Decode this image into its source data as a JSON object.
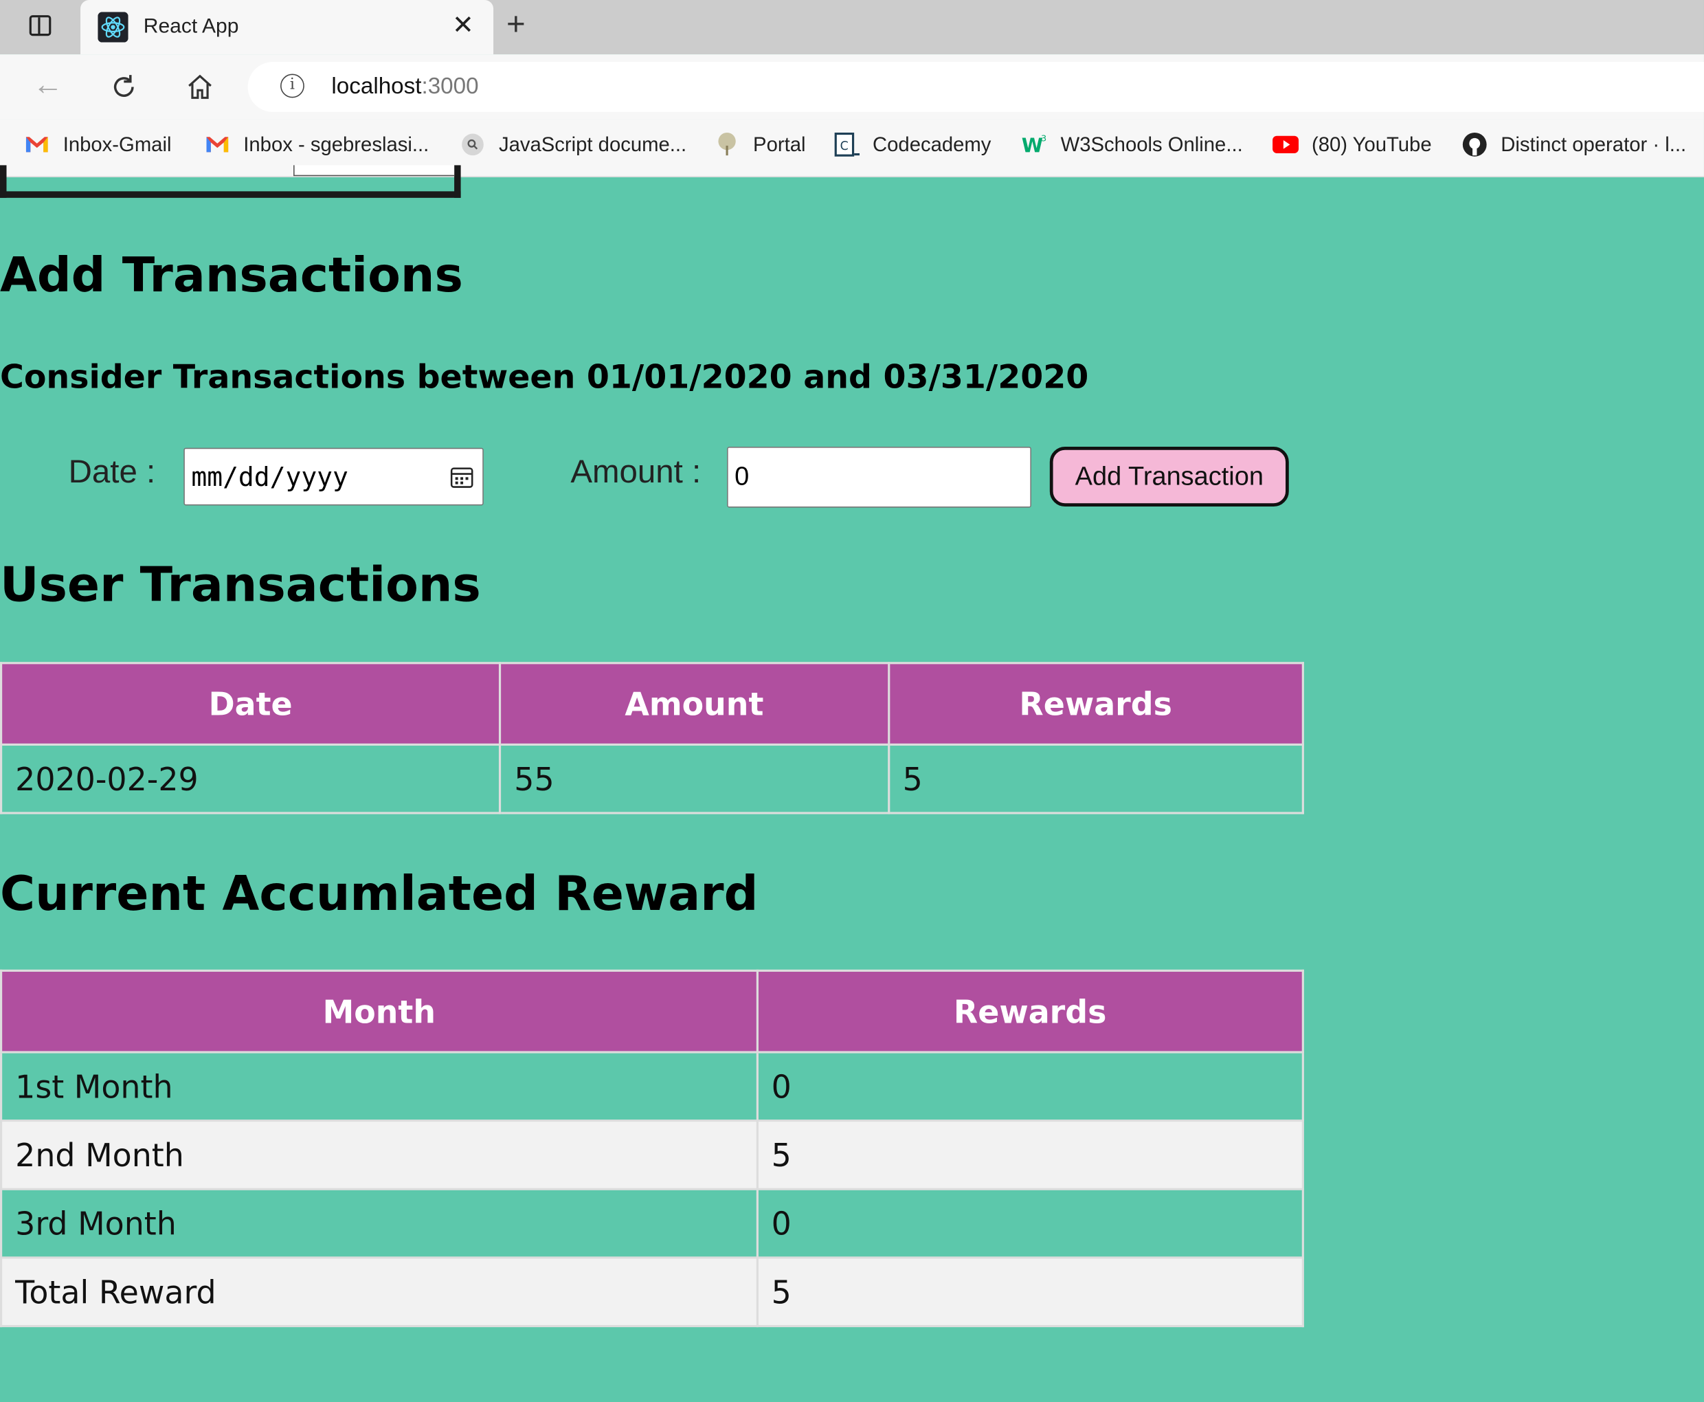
{
  "browser": {
    "tab_title": "React App",
    "url_host": "localhost",
    "url_port": ":3000",
    "bookmarks": [
      {
        "label": "Inbox-Gmail",
        "icon": "gmail-icon"
      },
      {
        "label": "Inbox - sgebreslasi...",
        "icon": "gmail-icon"
      },
      {
        "label": "JavaScript docume...",
        "icon": "search-globe-icon"
      },
      {
        "label": "Portal",
        "icon": "tree-icon"
      },
      {
        "label": "Codecademy",
        "icon": "codecademy-icon"
      },
      {
        "label": "W3Schools Online...",
        "icon": "w3schools-icon"
      },
      {
        "label": "(80) YouTube",
        "icon": "youtube-icon"
      },
      {
        "label": "Distinct operator · l...",
        "icon": "github-icon"
      }
    ]
  },
  "colors": {
    "page_bg": "#5cc8ab",
    "table_header": "#b04f9f",
    "button_bg": "#f5b8d7"
  },
  "add_section": {
    "title": "Add Transactions",
    "subtitle": "Consider Transactions between 01/01/2020 and 03/31/2020",
    "date_label": "Date :",
    "date_placeholder": "mm/dd/yyyy",
    "amount_label": "Amount :",
    "amount_value": "0",
    "button_label": "Add Transaction"
  },
  "transactions": {
    "title": "User Transactions",
    "headers": [
      "Date",
      "Amount",
      "Rewards"
    ],
    "rows": [
      [
        "2020-02-29",
        "55",
        "5"
      ]
    ]
  },
  "rewards": {
    "title": "Current Accumlated Reward",
    "headers": [
      "Month",
      "Rewards"
    ],
    "rows": [
      [
        "1st Month",
        "0"
      ],
      [
        "2nd Month",
        "5"
      ],
      [
        "3rd Month",
        "0"
      ],
      [
        "Total Reward",
        "5"
      ]
    ]
  }
}
